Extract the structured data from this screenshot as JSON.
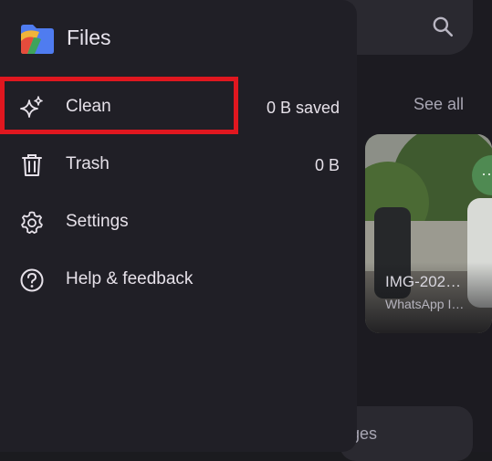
{
  "app": {
    "title": "Files"
  },
  "drawer": {
    "items": [
      {
        "label": "Clean",
        "icon": "sparkle-icon",
        "meta": "0 B saved"
      },
      {
        "label": "Trash",
        "icon": "trash-icon",
        "meta": "0 B"
      },
      {
        "label": "Settings",
        "icon": "gear-icon",
        "meta": ""
      },
      {
        "label": "Help & feedback",
        "icon": "help-icon",
        "meta": ""
      }
    ]
  },
  "background": {
    "see_all_label": "See all",
    "photo": {
      "name": "IMG-202…",
      "source": "WhatsApp I…"
    },
    "more_label": "···",
    "bottom_card_label": "ges"
  },
  "colors": {
    "drawer_bg": "#201f26",
    "highlight": "#e0171f",
    "fab_green": "#4f8a52"
  }
}
